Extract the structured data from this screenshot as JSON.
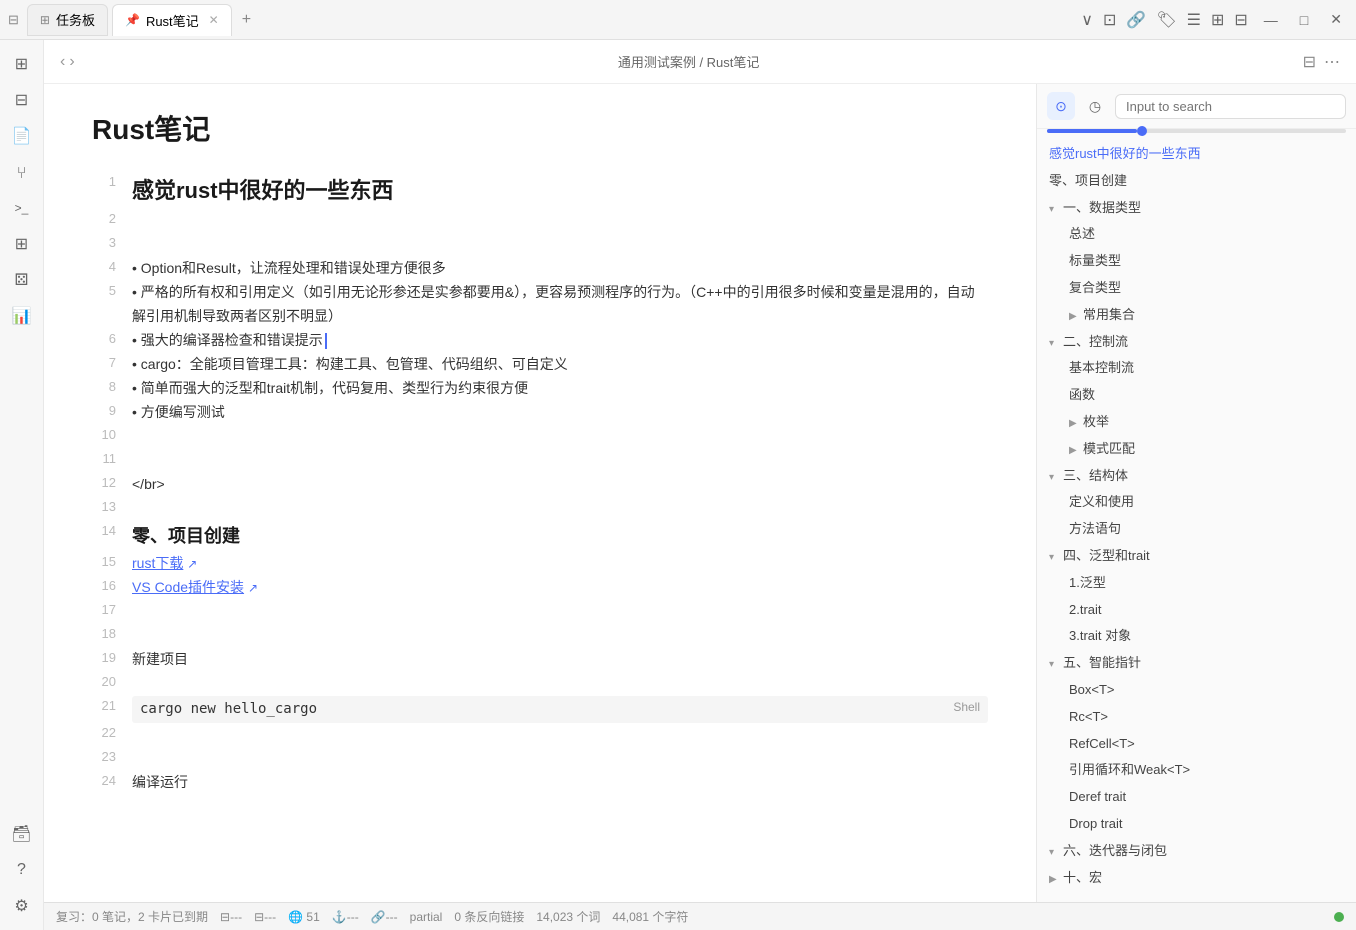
{
  "titleBar": {
    "tabs": [
      {
        "id": "tasks",
        "label": "任务板",
        "icon": "⊞",
        "active": false
      },
      {
        "id": "rust-notes",
        "label": "Rust笔记",
        "icon": "📌",
        "active": true
      }
    ],
    "addTab": "+",
    "winControls": [
      "—",
      "□",
      "✕"
    ]
  },
  "breadcrumb": {
    "back": "‹",
    "forward": "›",
    "path": "通用测试案例 / Rust笔记",
    "separator": "/",
    "actions": [
      "⊟",
      "⋯"
    ]
  },
  "sidebarIcons": [
    {
      "id": "grid",
      "icon": "⊞",
      "active": false
    },
    {
      "id": "apps",
      "icon": "⊟",
      "active": false
    },
    {
      "id": "file",
      "icon": "📄",
      "active": false
    },
    {
      "id": "branch",
      "icon": "⑂",
      "active": false
    },
    {
      "id": "terminal",
      "icon": ">_",
      "active": false
    },
    {
      "id": "blocks",
      "icon": "⊞",
      "active": false
    },
    {
      "id": "dice",
      "icon": "⚄",
      "active": false
    },
    {
      "id": "chart",
      "icon": "📊",
      "active": false
    },
    {
      "id": "database",
      "icon": "🗃",
      "active": false
    }
  ],
  "document": {
    "title": "Rust笔记",
    "lines": [
      {
        "num": "",
        "content": "",
        "type": "blank"
      },
      {
        "num": "1",
        "content": "感觉rust中很好的一些东西",
        "type": "heading1"
      },
      {
        "num": "2",
        "content": "",
        "type": "blank"
      },
      {
        "num": "3",
        "content": "",
        "type": "blank"
      },
      {
        "num": "4",
        "content": "• Option和Result，让流程处理和错误处理方便很多",
        "type": "bullet"
      },
      {
        "num": "5",
        "content": "• 严格的所有权和引用定义（如引用无论形参还是实参都要用&），更容易预测程序的行为。（C++中的引用很多时候和变量是混用的，自动解引用机制导致两者区别不明显）",
        "type": "bullet"
      },
      {
        "num": "6",
        "content": "• 强大的编译器检查和错误提示",
        "type": "bullet-highlight"
      },
      {
        "num": "7",
        "content": "• cargo：全能项目管理工具：构建工具、包管理、代码组织、可自定义",
        "type": "bullet"
      },
      {
        "num": "8",
        "content": "• 简单而强大的泛型和trait机制，代码复用、类型行为约束很方便",
        "type": "bullet"
      },
      {
        "num": "9",
        "content": "• 方便编写测试",
        "type": "bullet"
      },
      {
        "num": "10",
        "content": "",
        "type": "blank"
      },
      {
        "num": "11",
        "content": "",
        "type": "blank"
      },
      {
        "num": "12",
        "content": "</br>",
        "type": "code-tag"
      },
      {
        "num": "13",
        "content": "",
        "type": "blank"
      },
      {
        "num": "14",
        "content": "零、项目创建",
        "type": "heading2"
      },
      {
        "num": "15",
        "content": "rust下载 ↗",
        "type": "link"
      },
      {
        "num": "16",
        "content": "VS Code插件安装 ↗",
        "type": "link"
      },
      {
        "num": "17",
        "content": "",
        "type": "blank"
      },
      {
        "num": "18",
        "content": "",
        "type": "blank"
      },
      {
        "num": "19",
        "content": "新建项目",
        "type": "text"
      },
      {
        "num": "20",
        "content": "",
        "type": "blank"
      },
      {
        "num": "21",
        "content": "cargo new hello_cargo",
        "type": "code",
        "shellLabel": "Shell"
      },
      {
        "num": "22",
        "content": "",
        "type": "blank"
      },
      {
        "num": "23",
        "content": "",
        "type": "blank"
      },
      {
        "num": "24",
        "content": "编译运行",
        "type": "text"
      }
    ]
  },
  "rightPanel": {
    "searchPlaceholder": "Input to search",
    "toc": [
      {
        "label": "感觉rust中很好的一些东西",
        "level": 1,
        "active": true,
        "expanded": false
      },
      {
        "label": "零、项目创建",
        "level": 1,
        "active": false,
        "expanded": false
      },
      {
        "label": "一、数据类型",
        "level": 1,
        "active": false,
        "expanded": true,
        "children": [
          {
            "label": "总述",
            "level": 2
          },
          {
            "label": "标量类型",
            "level": 2
          },
          {
            "label": "复合类型",
            "level": 2
          },
          {
            "label": "常用集合",
            "level": 2,
            "hasToggle": true
          }
        ]
      },
      {
        "label": "二、控制流",
        "level": 1,
        "active": false,
        "expanded": true,
        "children": [
          {
            "label": "基本控制流",
            "level": 2
          },
          {
            "label": "函数",
            "level": 2
          },
          {
            "label": "枚举",
            "level": 2,
            "hasToggle": true
          },
          {
            "label": "模式匹配",
            "level": 2,
            "hasToggle": true
          }
        ]
      },
      {
        "label": "三、结构体",
        "level": 1,
        "active": false,
        "expanded": true,
        "children": [
          {
            "label": "定义和使用",
            "level": 2
          },
          {
            "label": "方法语句",
            "level": 2
          }
        ]
      },
      {
        "label": "四、泛型和trait",
        "level": 1,
        "active": false,
        "expanded": true,
        "children": [
          {
            "label": "1.泛型",
            "level": 2
          },
          {
            "label": "2.trait",
            "level": 2
          },
          {
            "label": "3.trait 对象",
            "level": 2
          }
        ]
      },
      {
        "label": "五、智能指针",
        "level": 1,
        "active": false,
        "expanded": true,
        "children": [
          {
            "label": "Box<T>",
            "level": 2
          },
          {
            "label": "Rc<T>",
            "level": 2
          },
          {
            "label": "RefCell<T>",
            "level": 2
          },
          {
            "label": "引用循环和Weak<T>",
            "level": 2
          },
          {
            "label": "Deref trait",
            "level": 2
          },
          {
            "label": "Drop trait",
            "level": 2
          }
        ]
      },
      {
        "label": "六、迭代器与闭包",
        "level": 1,
        "active": false,
        "expanded": false
      },
      {
        "label": "十、宏",
        "level": 1,
        "active": false,
        "expanded": false,
        "hasToggle": true
      }
    ]
  },
  "statusBar": {
    "review": "复习：0 笔记，2 卡片已到期",
    "dash1": "⊟---",
    "dash2": "⊟---",
    "count": "51",
    "links": "⊟---",
    "chain": "⊟---",
    "partial": "partial",
    "backlinks": "0 条反向链接",
    "wordCount": "14,023 个词",
    "charCount": "44,081 个字符",
    "status": "●"
  }
}
